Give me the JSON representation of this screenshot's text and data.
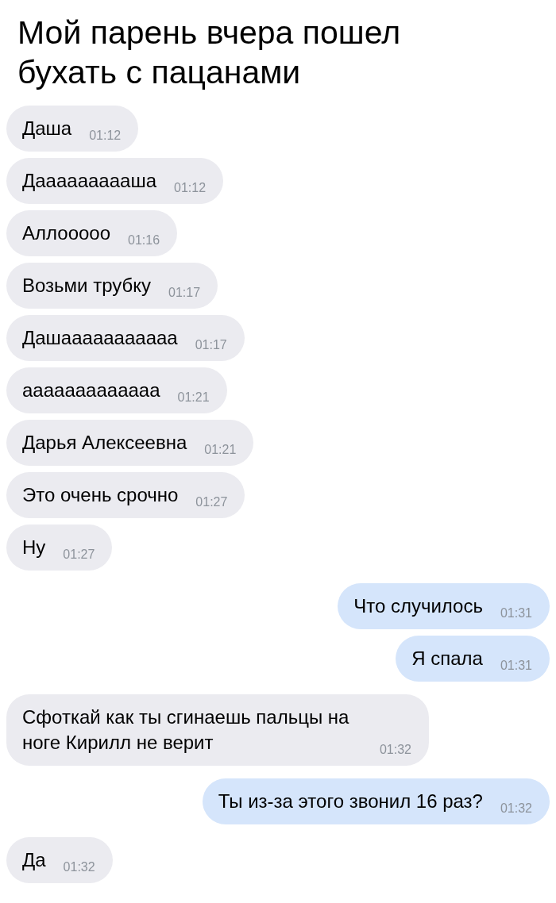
{
  "title": "Мой парень вчера пошел бухать с пацанами",
  "messages": [
    {
      "text": "Даша",
      "time": "01:12",
      "outgoing": false
    },
    {
      "text": "Даааааааааша",
      "time": "01:12",
      "outgoing": false
    },
    {
      "text": "Аллооооо",
      "time": "01:16",
      "outgoing": false
    },
    {
      "text": "Возьми трубку",
      "time": "01:17",
      "outgoing": false
    },
    {
      "text": "Дашааааааааааа",
      "time": "01:17",
      "outgoing": false
    },
    {
      "text": "ааааааааааааа",
      "time": "01:21",
      "outgoing": false
    },
    {
      "text": "Дарья Алексеевна",
      "time": "01:21",
      "outgoing": false
    },
    {
      "text": "Это очень срочно",
      "time": "01:27",
      "outgoing": false
    },
    {
      "text": "Ну",
      "time": "01:27",
      "outgoing": false
    },
    {
      "text": "Что случилось",
      "time": "01:31",
      "outgoing": true
    },
    {
      "text": "Я спала",
      "time": "01:31",
      "outgoing": true
    },
    {
      "text": "Сфоткай как ты сгинаешь пальцы на ноге Кирилл не верит",
      "time": "01:32",
      "outgoing": false
    },
    {
      "text": "Ты из-за этого звонил 16 раз?",
      "time": "01:32",
      "outgoing": true
    },
    {
      "text": "Да",
      "time": "01:32",
      "outgoing": false
    }
  ]
}
